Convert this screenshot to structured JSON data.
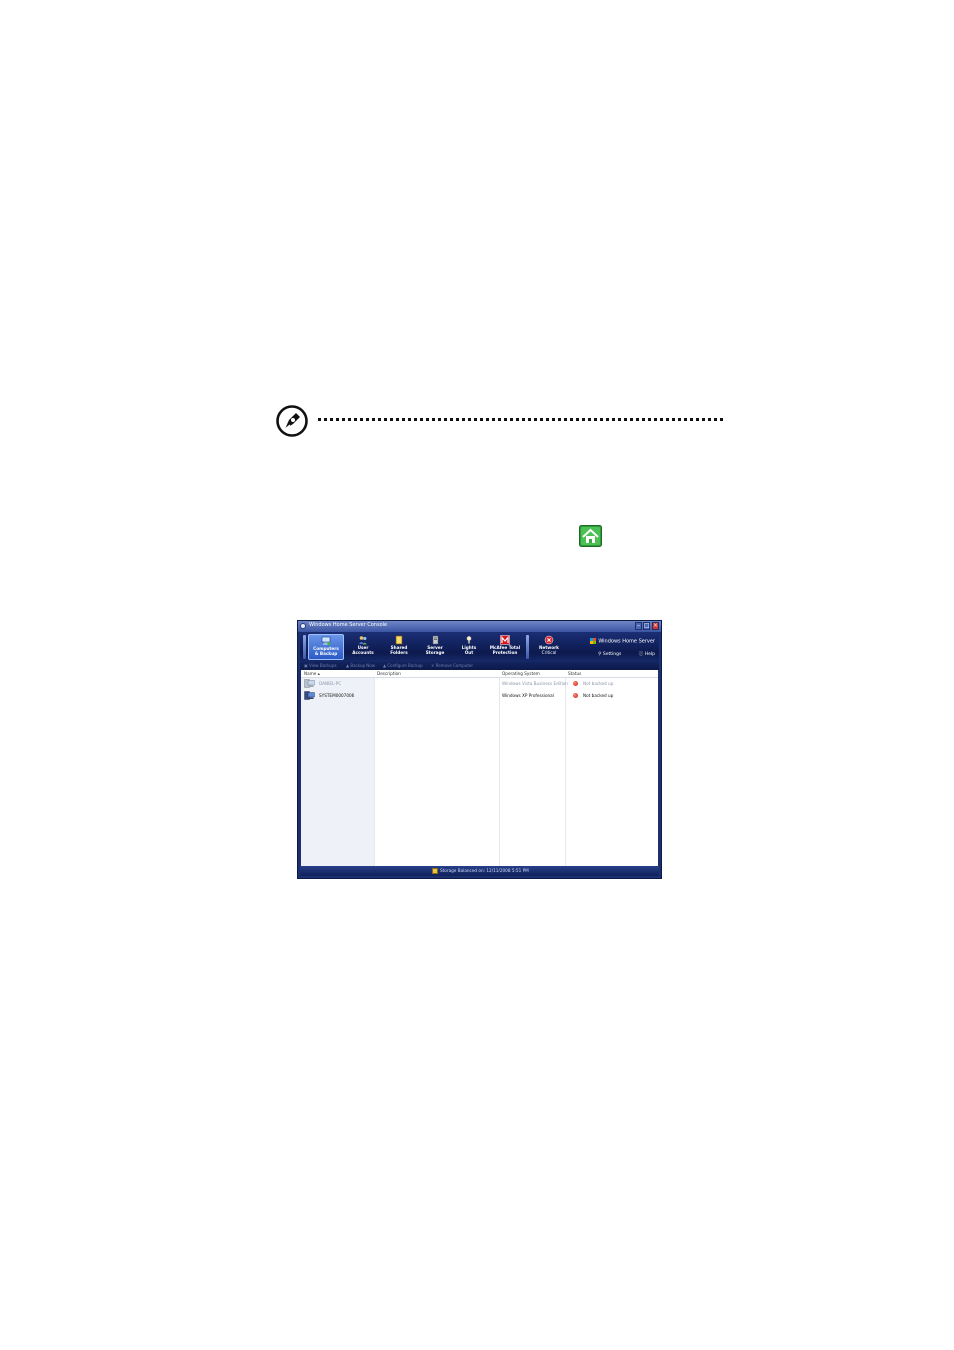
{
  "window": {
    "title": "Windows Home Server Console",
    "brand": "Windows Home Server",
    "settings_label": "Settings",
    "help_label": "Help"
  },
  "tabs": [
    {
      "label_1": "Computers",
      "label_2": "& Backup",
      "icon": "computers-backup-icon",
      "active": true
    },
    {
      "label_1": "User",
      "label_2": "Accounts",
      "icon": "users-icon",
      "active": false
    },
    {
      "label_1": "Shared",
      "label_2": "Folders",
      "icon": "folders-icon",
      "active": false
    },
    {
      "label_1": "Server",
      "label_2": "Storage",
      "icon": "storage-icon",
      "active": false
    },
    {
      "label_1": "Lights",
      "label_2": "Out",
      "icon": "lights-out-icon",
      "active": false
    },
    {
      "label_1": "McAfee Total",
      "label_2": "Protection",
      "icon": "mcafee-icon",
      "active": false
    },
    {
      "label_1": "Network",
      "label_2": "Critical",
      "icon": "network-critical-icon",
      "active": false
    }
  ],
  "toolbar": {
    "view_backups": "View Backups",
    "backup_now": "Backup Now",
    "configure_backup": "Configure Backup",
    "remove_computer": "Remove Computer"
  },
  "columns": {
    "name": "Name",
    "description": "Description",
    "os": "Operating System",
    "status": "Status"
  },
  "rows": [
    {
      "name": "DANIEL-PC",
      "description": "",
      "os": "Windows Vista Business Edition",
      "status": "Not backed up",
      "dimmed": true
    },
    {
      "name": "SYSTEM0007006",
      "description": "",
      "os": "Windows XP Professional",
      "status": "Not backed up",
      "dimmed": false
    }
  ],
  "statusbar": {
    "text": "Storage Balanced on: 12/11/2008 5:51 PM"
  },
  "colors": {
    "ribbon": "#0c1a4e",
    "accent": "#2c5ac6",
    "status_error": "#c01a10"
  }
}
